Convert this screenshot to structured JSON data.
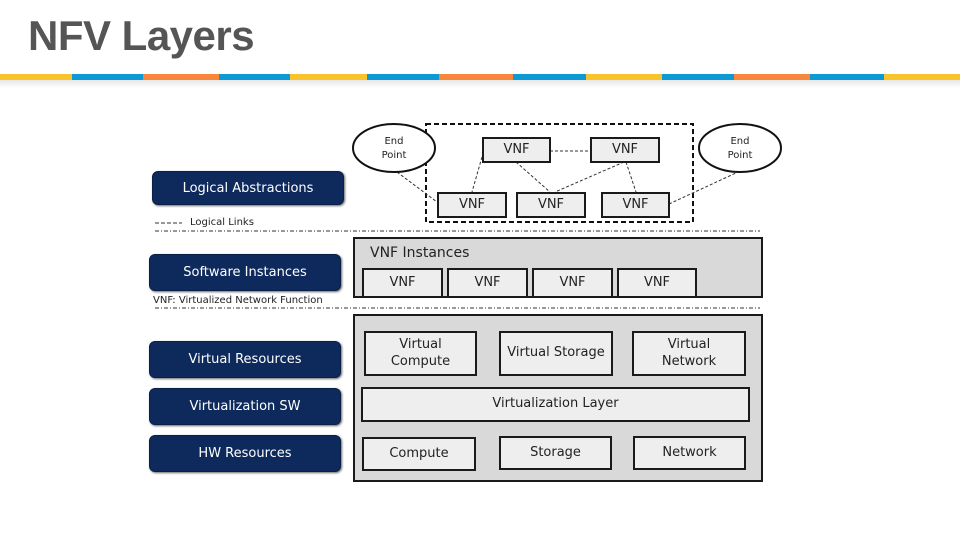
{
  "title": "NFV Layers",
  "stripe_colors": [
    "#f9c32c",
    "#0b9ad6",
    "#f7883b",
    "#0b9ad6",
    "#f9c32c",
    "#0b9ad6",
    "#f7883b",
    "#0b9ad6",
    "#f9c32c",
    "#0b9ad6",
    "#f7883b",
    "#0b9ad6",
    "#f9c32c"
  ],
  "layers": {
    "logical_abstractions": "Logical Abstractions",
    "software_instances": "Software Instances",
    "virtual_resources": "Virtual Resources",
    "virtualization_sw": "Virtualization SW",
    "hw_resources": "HW Resources"
  },
  "legend": {
    "logical_links": "Logical Links",
    "vnf_definition": "VNF: Virtualized Network Function"
  },
  "logical": {
    "end_point_left": [
      "End",
      "Point"
    ],
    "end_point_right": [
      "End",
      "Point"
    ],
    "top_vnfs": [
      "VNF",
      "VNF"
    ],
    "bottom_vnfs": [
      "VNF",
      "VNF",
      "VNF"
    ]
  },
  "instances": {
    "heading": "VNF Instances",
    "vnfs": [
      "VNF",
      "VNF",
      "VNF",
      "VNF"
    ]
  },
  "infrastructure": {
    "virtual": [
      "Virtual Compute",
      "Virtual Storage",
      "Virtual Network"
    ],
    "virtualization_layer": "Virtualization Layer",
    "physical": [
      "Compute",
      "Storage",
      "Network"
    ]
  },
  "colors": {
    "nav_box": "#0e2a5c",
    "panel": "#d9d9d9",
    "box": "#eeeeee",
    "title": "#555555"
  }
}
